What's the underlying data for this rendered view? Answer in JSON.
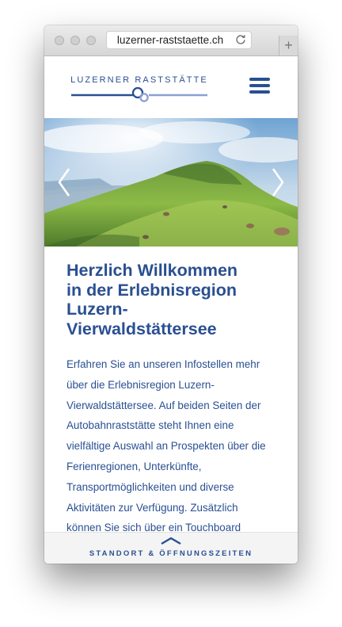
{
  "browser": {
    "url": "luzerner-raststaette.ch",
    "new_tab_label": "+"
  },
  "header": {
    "logo_text": "LUZERNER RASTSTÄTTE",
    "menu_icon": "hamburger-menu-icon"
  },
  "hero": {
    "prev_icon": "chevron-left-icon",
    "next_icon": "chevron-right-icon"
  },
  "main": {
    "heading_lines": [
      "Herzlich Willkommen",
      "in der Erlebnisregion",
      "Luzern-",
      "Vierwaldstättersee"
    ],
    "body_lines": [
      "Erfahren Sie an unseren Infostellen mehr",
      "über die Erlebnisregion Luzern-",
      "Vierwaldstättersee. Auf beiden Seiten der",
      "Autobahnraststätte steht Ihnen eine",
      "vielfältige Auswahl an Prospekten über die",
      "Ferienregionen, Unterkünfte,",
      "Transportmöglichkeiten und diverse",
      "Aktivitäten zur Verfügung. Zusätzlich",
      "können Sie sich über ein Touchboard"
    ]
  },
  "footer": {
    "label": "STANDORT & ÖFFNUNGSZEITEN",
    "icon": "chevron-up-icon"
  },
  "colors": {
    "brand_blue": "#2a4f92",
    "logo_light_blue": "#8aa0d4"
  }
}
